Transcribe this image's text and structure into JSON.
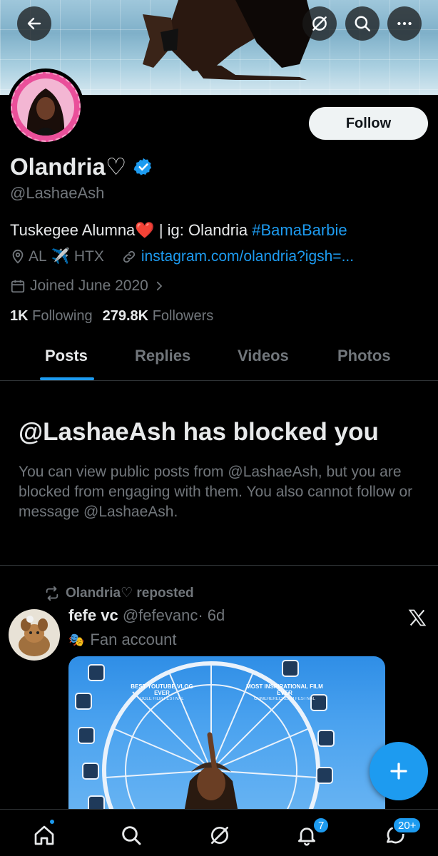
{
  "profile": {
    "display_name": "Olandria♡",
    "handle": "@LashaeAsh",
    "bio_text": "Tuskegee Alumna",
    "bio_ig": " | ig: Olandria ",
    "bio_hashtag": "#BamaBarbie",
    "location": "AL",
    "location2": "HTX",
    "website": "instagram.com/olandria?igsh=...",
    "joined": "Joined June 2020",
    "following_count": "1K",
    "following_label": "Following",
    "followers_count": "279.8K",
    "followers_label": "Followers"
  },
  "actions": {
    "follow_label": "Follow"
  },
  "tabs": [
    {
      "label": "Posts"
    },
    {
      "label": "Replies"
    },
    {
      "label": "Videos"
    },
    {
      "label": "Photos"
    }
  ],
  "blocked": {
    "title": "@LashaeAsh has blocked you",
    "text": "You can view public posts from @LashaeAsh, but you are blocked from engaging with them. You also cannot follow or message @LashaeAsh."
  },
  "post": {
    "repost_label": "Olandria♡ reposted",
    "author_name": "fefe vc",
    "author_handle": "@fefevanc",
    "time": "· 6d",
    "account_label": "Fan account",
    "media_awards": [
      {
        "title": "BEST YOUTUBE VLOG EVER",
        "sub": "DOLE FILM FESTIVAL"
      },
      {
        "title": "MOST INSPIRATIONAL FILM EVER",
        "sub": "COMEHERECREAM FESTIVAL"
      }
    ]
  },
  "nav": {
    "notifications_badge": "7",
    "messages_badge": "20+"
  },
  "colors": {
    "accent": "#1d9bf0",
    "background": "#000000",
    "text_primary": "#e7e9ea",
    "text_secondary": "#71767b"
  }
}
